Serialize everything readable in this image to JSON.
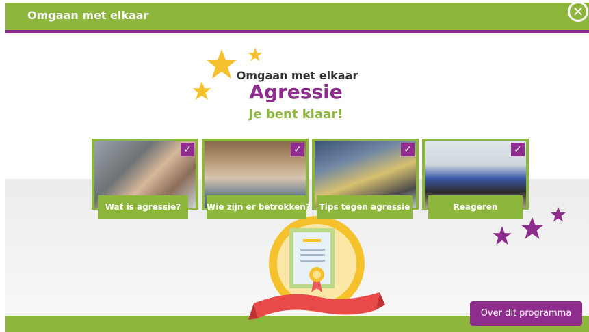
{
  "header": {
    "title": "Omgaan met elkaar"
  },
  "close": {
    "label": "✕"
  },
  "main": {
    "subtitle": "Omgaan met elkaar",
    "title": "Agressie",
    "status": "Je bent klaar!"
  },
  "cards": [
    {
      "label": "Wat is agressie?",
      "check": "✓"
    },
    {
      "label": "Wie zijn er betrokken?",
      "check": "✓"
    },
    {
      "label": "Tips tegen agressie",
      "check": "✓"
    },
    {
      "label": "Reageren",
      "check": "✓"
    }
  ],
  "footer": {
    "about_label": "Over dit programma"
  },
  "colors": {
    "green": "#8db63c",
    "purple": "#8e2d8d",
    "gold": "#f5c22e"
  },
  "icons": [
    "close-icon",
    "check-icon",
    "star-icon",
    "certificate-icon"
  ]
}
